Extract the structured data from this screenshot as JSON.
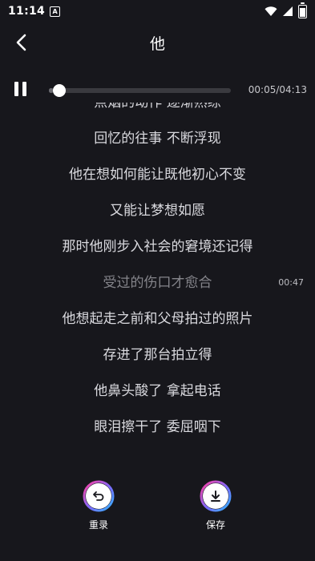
{
  "status_bar": {
    "time": "11:14",
    "notification_glyph": "A"
  },
  "header": {
    "title": "他"
  },
  "player": {
    "elapsed_and_total": "00:05/04:13",
    "progress_fraction": 0.02
  },
  "lyrics": {
    "lines": [
      {
        "text": "点烟的动作 逐渐熟练",
        "current": false
      },
      {
        "text": "回忆的往事 不断浮现",
        "current": false
      },
      {
        "text": "他在想如何能让既他初心不变",
        "current": false
      },
      {
        "text": "又能让梦想如愿",
        "current": false
      },
      {
        "text": "那时他刚步入社会的窘境还记得",
        "current": false
      },
      {
        "text": "受过的伤口才愈合",
        "current": true,
        "time": "00:47"
      },
      {
        "text": "他想起走之前和父母拍过的照片",
        "current": false
      },
      {
        "text": "存进了那台拍立得",
        "current": false
      },
      {
        "text": "他鼻头酸了 拿起电话",
        "current": false
      },
      {
        "text": "眼泪擦干了 委屈咽下",
        "current": false
      }
    ]
  },
  "actions": {
    "rerecord_label": "重录",
    "save_label": "保存"
  },
  "colors": {
    "background": "#17171c",
    "accent_gradient": [
      "#ff3f9e",
      "#7b6bff",
      "#2fb8ff"
    ]
  }
}
